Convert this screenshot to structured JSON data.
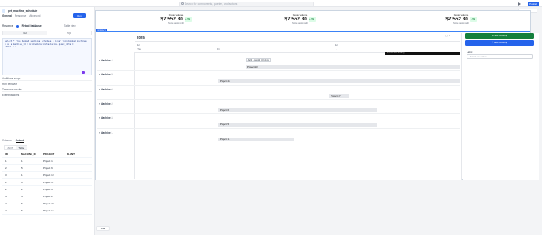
{
  "topbar": {
    "search_placeholder": "Search for components, queries, and actions",
    "right_label": "Publish"
  },
  "left": {
    "query_name": "get_machine_schedule",
    "tabs": [
      "General",
      "Response",
      "Advanced"
    ],
    "run_label": "Run",
    "resource_label": "Resource",
    "resource_value": "Retool Database",
    "table_view": "Table view",
    "mode_tabs": [
      "GUI",
      "SQL"
    ],
    "code_lines": [
      "select * from booked_machines_schedule s inner join booked_machines",
      "m on s.machine_id = m.id where installation.plant_date =",
      "'2025' ..."
    ],
    "sections": [
      "Additional scope",
      "Run behavior",
      "Transform results",
      "Event handlers"
    ],
    "bottom_tabs": [
      "Schema",
      "Output"
    ],
    "output_tabs": [
      "JSON",
      "Table"
    ],
    "table": {
      "headers": [
        "ID",
        "MACHINE_ID",
        "PROJECT",
        "PLANT"
      ],
      "rows": [
        [
          "1",
          "1",
          "Project 1",
          ""
        ],
        [
          "2",
          "5",
          "Project 6",
          ""
        ],
        [
          "3",
          "1",
          "Project 13",
          ""
        ],
        [
          "1",
          "3",
          "Project 11",
          ""
        ],
        [
          "2",
          "2",
          "Project 6",
          ""
        ],
        [
          "4",
          "4",
          "Project 27",
          ""
        ],
        [
          "4",
          "6",
          "Project 28",
          ""
        ],
        [
          "4",
          "6",
          "Project 15",
          ""
        ]
      ]
    }
  },
  "metrics": [
    {
      "title": "Gross volume",
      "value": "$7,552.80",
      "delta": "+ 5%",
      "sub": "Since past month"
    },
    {
      "title": "Gross volume",
      "value": "$7,552.80",
      "delta": "+ 5%",
      "sub": "Since past month"
    },
    {
      "title": "Gross volume",
      "value": "$7,552.80",
      "delta": "+ 5%",
      "sub": "Since past month"
    }
  ],
  "container_tag": "container1",
  "gantt": {
    "year": "2025",
    "month_left": "Jul",
    "month_right": "Jul",
    "day_left": "Thu",
    "day_mid": "Fri",
    "today_tooltip": "Jul 3 - Aug 11 (40 days)",
    "construction_label": "Construction holiday",
    "machines": [
      "Machine 4",
      "Machine 5",
      "Machine 6",
      "Machine 2",
      "Machine 3",
      "Machine 1"
    ],
    "bars": [
      {
        "label": "Project 13",
        "row": 0
      },
      {
        "label": "Project 25",
        "row": 1
      },
      {
        "label": "Project 27",
        "row": 2
      },
      {
        "label": "Project 6",
        "row": 3
      },
      {
        "label": "Project 5",
        "row": 4
      },
      {
        "label": "Project 11",
        "row": 5
      }
    ]
  },
  "right": {
    "new_booking": "New Booking",
    "edit_booking": "Edit Booking",
    "label": "Label",
    "select_placeholder": "Select an option"
  },
  "footer": {
    "pill": "TRIB"
  },
  "top_right": {
    "dropdown": "Viewport"
  }
}
